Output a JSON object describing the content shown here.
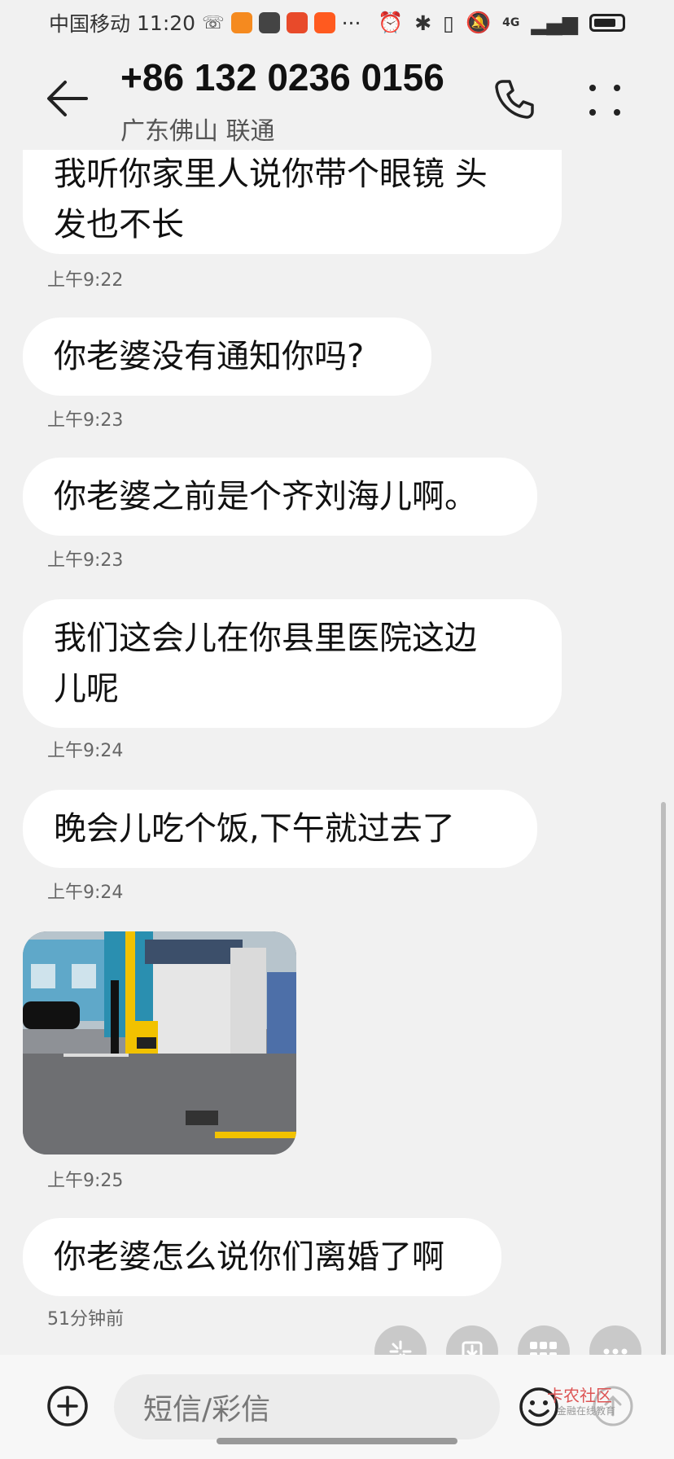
{
  "status_bar": {
    "carrier": "中国移动",
    "time": "11:20",
    "more": "···",
    "network": "4G"
  },
  "header": {
    "title": "+86 132 0236 0156",
    "subtitle": "广东佛山 联通"
  },
  "messages": [
    {
      "text_line1": "我听你家里人说你带个眼镜 头",
      "text_line2": "发也不长",
      "time": "上午9:22"
    },
    {
      "text": "你老婆没有通知你吗?",
      "time": "上午9:23"
    },
    {
      "text": "你老婆之前是个齐刘海儿啊。",
      "time": "上午9:23"
    },
    {
      "text_line1": "我们这会儿在你县里医院这边",
      "text_line2": "儿呢",
      "time": "上午9:24"
    },
    {
      "text": "晚会儿吃个饭,下午就过去了",
      "time": "上午9:24"
    },
    {
      "type": "image",
      "time": "上午9:25"
    },
    {
      "text": "你老婆怎么说你们离婚了啊",
      "time": "51分钟前"
    }
  ],
  "composer": {
    "placeholder": "短信/彩信"
  },
  "watermark": {
    "text": "卡农社区",
    "sub": "金融在线教育"
  },
  "colors": {
    "background": "#f1f1f1",
    "bubble": "#ffffff",
    "float_button": "#c9c9c9"
  }
}
